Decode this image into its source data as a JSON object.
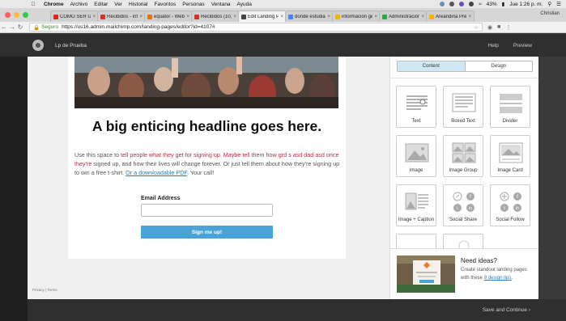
{
  "menubar": {
    "app": "Chrome",
    "items": [
      "Archivo",
      "Editar",
      "Ver",
      "Historial",
      "Favoritos",
      "Personas",
      "Ventana",
      "Ayuda"
    ],
    "battery": "43%",
    "clock": "Jue 1:26 p. m."
  },
  "browser": {
    "profile": "Christian",
    "tabs": [
      {
        "label": "CÓMO SER Ú",
        "fav_color": "#e62117",
        "active": false
      },
      {
        "label": "Recibidos - inf",
        "fav_color": "#d93025",
        "active": false
      },
      {
        "label": "equator - Web",
        "fav_color": "#e8710a",
        "active": false
      },
      {
        "label": "Recibidos (10,4",
        "fav_color": "#d93025",
        "active": false
      },
      {
        "label": "Edit Landing P",
        "fav_color": "#444444",
        "active": true
      },
      {
        "label": "donde estudiar",
        "fav_color": "#4285f4",
        "active": false
      },
      {
        "label": "información ge",
        "fav_color": "#f4b400",
        "active": false
      },
      {
        "label": "Administración",
        "fav_color": "#2aa84a",
        "active": false
      },
      {
        "label": "Areandina Pre",
        "fav_color": "#f4b400",
        "active": false
      }
    ],
    "secure_label": "Seguro",
    "url": "https://us16.admin.mailchimp.com/landing-pages/editor?id=4107#"
  },
  "app_header": {
    "page_name": "Lp de Prueba",
    "help": "Help",
    "preview": "Preview"
  },
  "landing": {
    "headline": "A big enticing headline goes here.",
    "body_plain_1": "Use this space to ",
    "body_red": "tell people what they get for signing up. Maybe tell them how grd s asd dad asd once they're",
    "body_plain_2": " signed up, and how their lives will change forever. Or just tell them about how they're signing up to win a free t-shirt. ",
    "body_link": "Or a downloadable PDF",
    "body_plain_3": ". Your call!",
    "email_label": "Email Address",
    "email_value": "",
    "signup_button": "Sign me up!",
    "footer_links": "Privacy | Terms"
  },
  "panel": {
    "tabs": {
      "content": "Content",
      "design": "Design"
    },
    "blocks": [
      {
        "label": "Text",
        "icon": "text-block-icon"
      },
      {
        "label": "Boxed Text",
        "icon": "boxed-text-block-icon"
      },
      {
        "label": "Divider",
        "icon": "divider-block-icon"
      },
      {
        "label": "Image",
        "icon": "image-block-icon"
      },
      {
        "label": "Image Group",
        "icon": "image-group-block-icon"
      },
      {
        "label": "Image Card",
        "icon": "image-card-block-icon"
      },
      {
        "label": "Image + Caption",
        "icon": "image-caption-block-icon"
      },
      {
        "label": "Social Share",
        "icon": "social-share-block-icon"
      },
      {
        "label": "Social Follow",
        "icon": "social-follow-block-icon"
      }
    ],
    "ideas_title": "Need ideas?",
    "ideas_text_1": "Create standout landing pages with these ",
    "ideas_link": "9 design tips",
    "ideas_text_2": "."
  },
  "footer": {
    "save_continue": "Save and Continue"
  },
  "colors": {
    "accent_blue": "#4aa3d6",
    "text_red": "#b22d4a",
    "header_dark": "#2f2f2f"
  }
}
